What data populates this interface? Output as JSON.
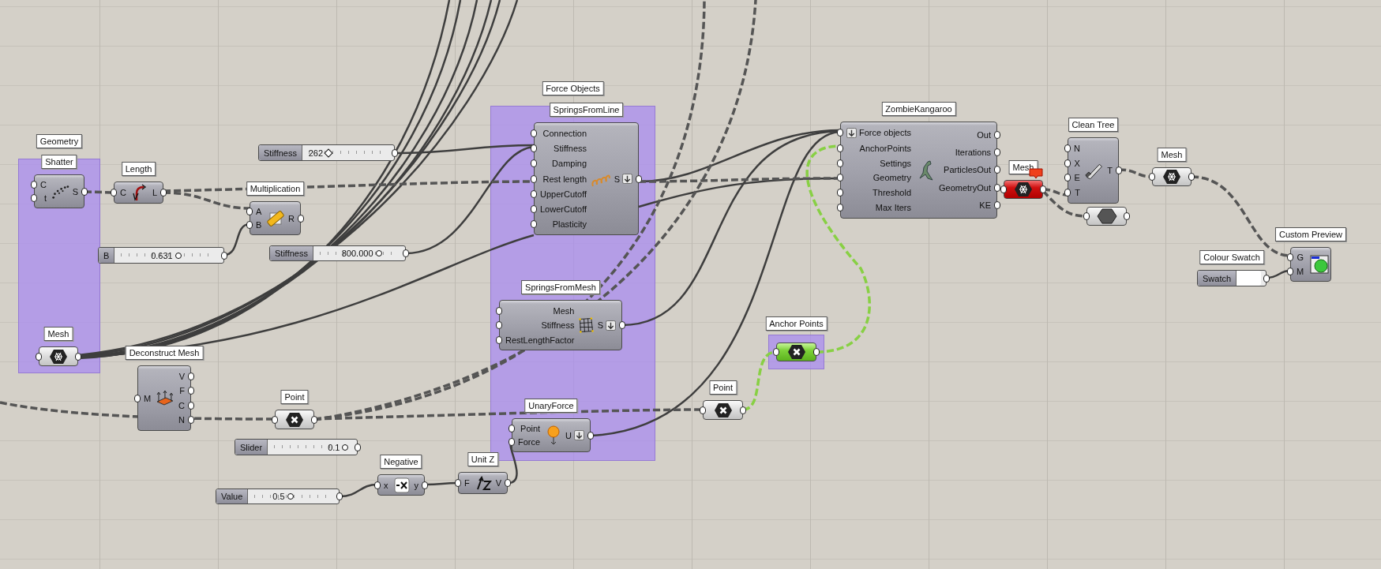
{
  "groups": [
    {
      "label": "Geometry"
    },
    {
      "label": "Force Objects"
    },
    {
      "label": "Anchor Points"
    }
  ],
  "components": [
    {
      "kind": "component",
      "label": "Shatter",
      "selected": false,
      "error": false,
      "inputs": [
        {
          "name": "C",
          "flatten": false
        },
        {
          "name": "t",
          "flatten": false
        }
      ],
      "outputs": [
        {
          "name": "S",
          "flatten": false
        }
      ]
    },
    {
      "kind": "component",
      "label": "Length",
      "selected": false,
      "error": false,
      "inputs": [
        {
          "name": "C",
          "flatten": false
        }
      ],
      "outputs": [
        {
          "name": "L",
          "flatten": false
        }
      ]
    },
    {
      "kind": "component",
      "label": "Multiplication",
      "selected": false,
      "error": false,
      "inputs": [
        {
          "name": "A",
          "flatten": false
        },
        {
          "name": "B",
          "flatten": false
        }
      ],
      "outputs": [
        {
          "name": "R",
          "flatten": false
        }
      ]
    },
    {
      "kind": "slider",
      "name": "B",
      "value": "0.631",
      "level": 0.61
    },
    {
      "kind": "slider",
      "name": "Stiffness",
      "value": "262",
      "level": 0.3
    },
    {
      "kind": "slider",
      "name": "Stiffness",
      "value": "800.000",
      "level": 0.75
    },
    {
      "kind": "param",
      "label": "Mesh",
      "selected": false,
      "error": false
    },
    {
      "kind": "component",
      "label": "Deconstruct Mesh",
      "selected": false,
      "error": false,
      "inputs": [
        {
          "name": "M",
          "flatten": false
        }
      ],
      "outputs": [
        {
          "name": "V",
          "flatten": false
        },
        {
          "name": "F",
          "flatten": false
        },
        {
          "name": "C",
          "flatten": false
        },
        {
          "name": "N",
          "flatten": false
        }
      ]
    },
    {
      "kind": "param",
      "label": "Point",
      "selected": false,
      "error": false
    },
    {
      "kind": "slider",
      "name": "Slider",
      "value": "0.1",
      "level": 0.92
    },
    {
      "kind": "slider",
      "name": "Value",
      "value": "0.5",
      "level": 0.49
    },
    {
      "kind": "component",
      "label": "Negative",
      "selected": false,
      "error": false,
      "inputs": [
        {
          "name": "x",
          "flatten": false
        }
      ],
      "outputs": [
        {
          "name": "y",
          "flatten": false
        }
      ]
    },
    {
      "kind": "component",
      "label": "Unit Z",
      "selected": false,
      "error": false,
      "inputs": [
        {
          "name": "F",
          "flatten": false
        }
      ],
      "outputs": [
        {
          "name": "V",
          "flatten": false
        }
      ]
    },
    {
      "kind": "component",
      "label": "SpringsFromLine",
      "selected": false,
      "error": false,
      "inputs": [
        {
          "name": "Connection",
          "flatten": false
        },
        {
          "name": "Stiffness",
          "flatten": false
        },
        {
          "name": "Damping",
          "flatten": false
        },
        {
          "name": "Rest length",
          "flatten": false
        },
        {
          "name": "UpperCutoff",
          "flatten": false
        },
        {
          "name": "LowerCutoff",
          "flatten": false
        },
        {
          "name": "Plasticity",
          "flatten": false
        }
      ],
      "outputs": [
        {
          "name": "S",
          "flatten": true
        }
      ]
    },
    {
      "kind": "component",
      "label": "SpringsFromMesh",
      "selected": false,
      "error": false,
      "inputs": [
        {
          "name": "Mesh",
          "flatten": false
        },
        {
          "name": "Stiffness",
          "flatten": false
        },
        {
          "name": "RestLengthFactor",
          "flatten": false
        }
      ],
      "outputs": [
        {
          "name": "S",
          "flatten": true
        }
      ]
    },
    {
      "kind": "component",
      "label": "UnaryForce",
      "selected": false,
      "error": false,
      "inputs": [
        {
          "name": "Point",
          "flatten": false
        },
        {
          "name": "Force",
          "flatten": false
        }
      ],
      "outputs": [
        {
          "name": "U",
          "flatten": true
        }
      ]
    },
    {
      "kind": "param",
      "selected": true,
      "error": false
    },
    {
      "kind": "param",
      "label": "Point",
      "selected": false,
      "error": false
    },
    {
      "kind": "component",
      "label": "ZombieKangaroo",
      "selected": false,
      "error": false,
      "inputs": [
        {
          "name": "Force objects",
          "flatten": true
        },
        {
          "name": "AnchorPoints",
          "flatten": false
        },
        {
          "name": "Settings",
          "flatten": false
        },
        {
          "name": "Geometry",
          "flatten": false
        },
        {
          "name": "Threshold",
          "flatten": false
        },
        {
          "name": "Max Iters",
          "flatten": false
        }
      ],
      "outputs": [
        {
          "name": "Out",
          "flatten": false
        },
        {
          "name": "Iterations",
          "flatten": false
        },
        {
          "name": "ParticlesOut",
          "flatten": false
        },
        {
          "name": "GeometryOut",
          "flatten": false
        },
        {
          "name": "KE",
          "flatten": false
        }
      ]
    },
    {
      "kind": "param",
      "label": "Mesh",
      "selected": false,
      "error": true
    },
    {
      "kind": "component",
      "label": "Clean Tree",
      "selected": false,
      "error": false,
      "inputs": [
        {
          "name": "N",
          "flatten": false
        },
        {
          "name": "X",
          "flatten": false
        },
        {
          "name": "E",
          "flatten": false
        },
        {
          "name": "T",
          "flatten": false
        }
      ],
      "outputs": [
        {
          "name": "T",
          "flatten": false
        }
      ]
    },
    {
      "kind": "param",
      "selected": false,
      "error": false
    },
    {
      "kind": "param",
      "label": "Mesh",
      "selected": false,
      "error": false
    },
    {
      "kind": "swatch",
      "label": "Colour Swatch",
      "name": "Swatch"
    },
    {
      "kind": "component",
      "label": "Custom Preview",
      "selected": false,
      "error": false,
      "inputs": [
        {
          "name": "G",
          "flatten": false
        },
        {
          "name": "M",
          "flatten": false
        }
      ]
    }
  ]
}
